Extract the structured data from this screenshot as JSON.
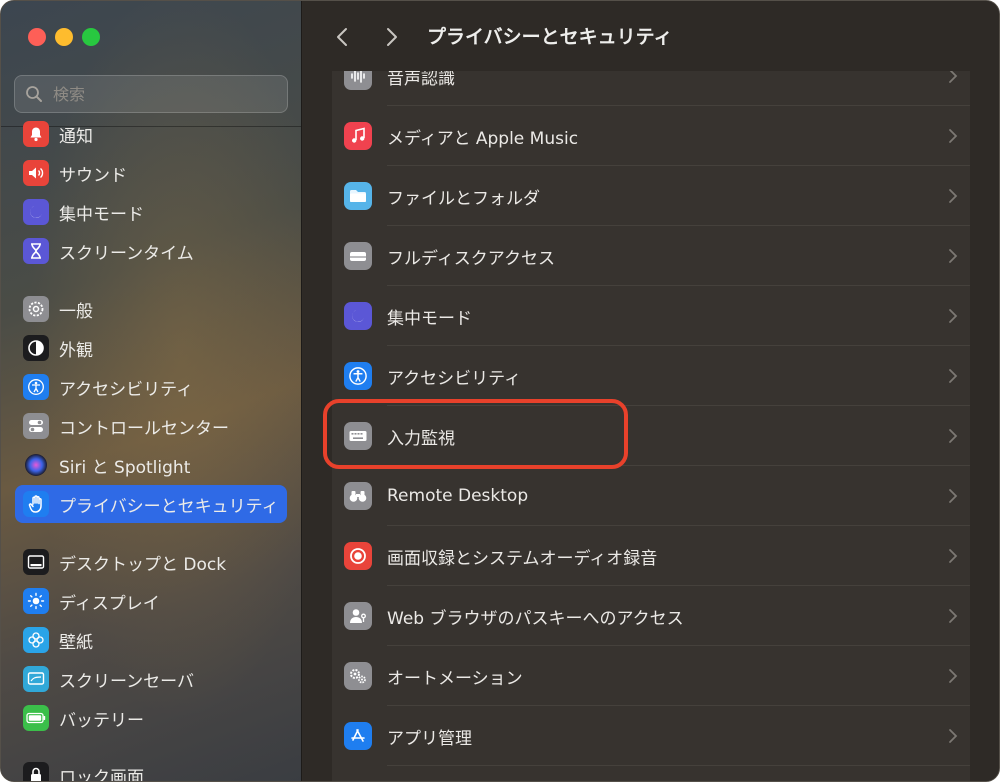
{
  "window": {
    "title": "プライバシーとセキュリティ"
  },
  "search": {
    "placeholder": "検索"
  },
  "sidebar": {
    "items": [
      {
        "label": "通知",
        "icon": "bell-icon",
        "color": "#e9443a"
      },
      {
        "label": "サウンド",
        "icon": "speaker-icon",
        "color": "#e9443a"
      },
      {
        "label": "集中モード",
        "icon": "moon-icon",
        "color": "#5b57d6"
      },
      {
        "label": "スクリーンタイム",
        "icon": "hourglass-icon",
        "color": "#5b57d6"
      },
      {
        "label": "一般",
        "icon": "gear-icon",
        "color": "#8e8e92"
      },
      {
        "label": "外観",
        "icon": "appearance-icon",
        "color": "#1c1c1e"
      },
      {
        "label": "アクセシビリティ",
        "icon": "accessibility-icon",
        "color": "#1f7ef0"
      },
      {
        "label": "コントロールセンター",
        "icon": "toggles-icon",
        "color": "#8e8e92"
      },
      {
        "label": "Siri と Spotlight",
        "icon": "siri-icon",
        "color": "#222222"
      },
      {
        "label": "プライバシーとセキュリティ",
        "icon": "hand-icon",
        "color": "#1f7ef0",
        "selected": true
      },
      {
        "label": "デスクトップと Dock",
        "icon": "dock-icon",
        "color": "#1c1c1e"
      },
      {
        "label": "ディスプレイ",
        "icon": "sun-icon",
        "color": "#1f7ef0"
      },
      {
        "label": "壁紙",
        "icon": "flower-icon",
        "color": "#2aa4e8"
      },
      {
        "label": "スクリーンセーバ",
        "icon": "screensaver-icon",
        "color": "#31a8d8"
      },
      {
        "label": "バッテリー",
        "icon": "battery-icon",
        "color": "#3bbf4a"
      },
      {
        "label": "ロック画面",
        "icon": "lock-icon",
        "color": "#1c1c1e"
      }
    ]
  },
  "main": {
    "rows": [
      {
        "label": "音声認識",
        "icon": "waveform-icon",
        "color": "#8e8e92"
      },
      {
        "label": "メディアと Apple Music",
        "icon": "music-note-icon",
        "color": "#f0424f"
      },
      {
        "label": "ファイルとフォルダ",
        "icon": "folder-icon",
        "color": "#56b4e9"
      },
      {
        "label": "フルディスクアクセス",
        "icon": "disk-icon",
        "color": "#8e8e92"
      },
      {
        "label": "集中モード",
        "icon": "moon-icon",
        "color": "#5b57d6"
      },
      {
        "label": "アクセシビリティ",
        "icon": "accessibility-icon",
        "color": "#1f7ef0"
      },
      {
        "label": "入力監視",
        "icon": "keyboard-icon",
        "color": "#8e8e92",
        "highlighted": true
      },
      {
        "label": "Remote Desktop",
        "icon": "binoculars-icon",
        "color": "#8e8e92"
      },
      {
        "label": "画面収録とシステムオーディオ録音",
        "icon": "record-icon",
        "color": "#e9443a"
      },
      {
        "label": "Web ブラウザのパスキーへのアクセス",
        "icon": "person-key-icon",
        "color": "#8e8e92"
      },
      {
        "label": "オートメーション",
        "icon": "gears-icon",
        "color": "#8e8e92"
      },
      {
        "label": "アプリ管理",
        "icon": "app-store-icon",
        "color": "#1f7ef0"
      }
    ]
  },
  "annotation": {
    "color": "#e8412b"
  }
}
